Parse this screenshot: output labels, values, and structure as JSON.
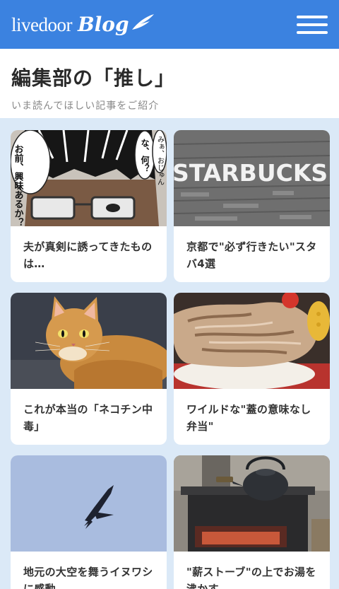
{
  "header": {
    "logo_word": "livedoor",
    "logo_blog": "Blog"
  },
  "intro": {
    "title": "編集部の「推し」",
    "subtitle": "いま読んでほしい記事をご紹介"
  },
  "articles": [
    {
      "title": "夫が真剣に誘ってきたものは…",
      "image": "manga-glasses-man-image"
    },
    {
      "title": "京都で\"必ず行きたい\"スタバ4選",
      "image": "starbucks-sign-image"
    },
    {
      "title": "これが本当の「ネコチン中毒」",
      "image": "orange-cat-image"
    },
    {
      "title": "ワイルドな\"蓋の意味なし弁当\"",
      "image": "meat-bento-image"
    },
    {
      "title": "地元の大空を舞うイヌワシに感動",
      "image": "eagle-sky-image"
    },
    {
      "title": "\"薪ストーブ\"の上でお湯を沸かす",
      "image": "wood-stove-kettle-image"
    }
  ],
  "thumb_text": {
    "manga_bubble_left": "お前、興味あるか？",
    "manga_bubble_mid": "な、何？",
    "manga_bubble_right": "みぁ、おじゅん",
    "starbucks_sign": "STARBUCKS"
  },
  "colors": {
    "header_bg": "#3b82e0",
    "grid_bg": "#dbe9f7"
  }
}
